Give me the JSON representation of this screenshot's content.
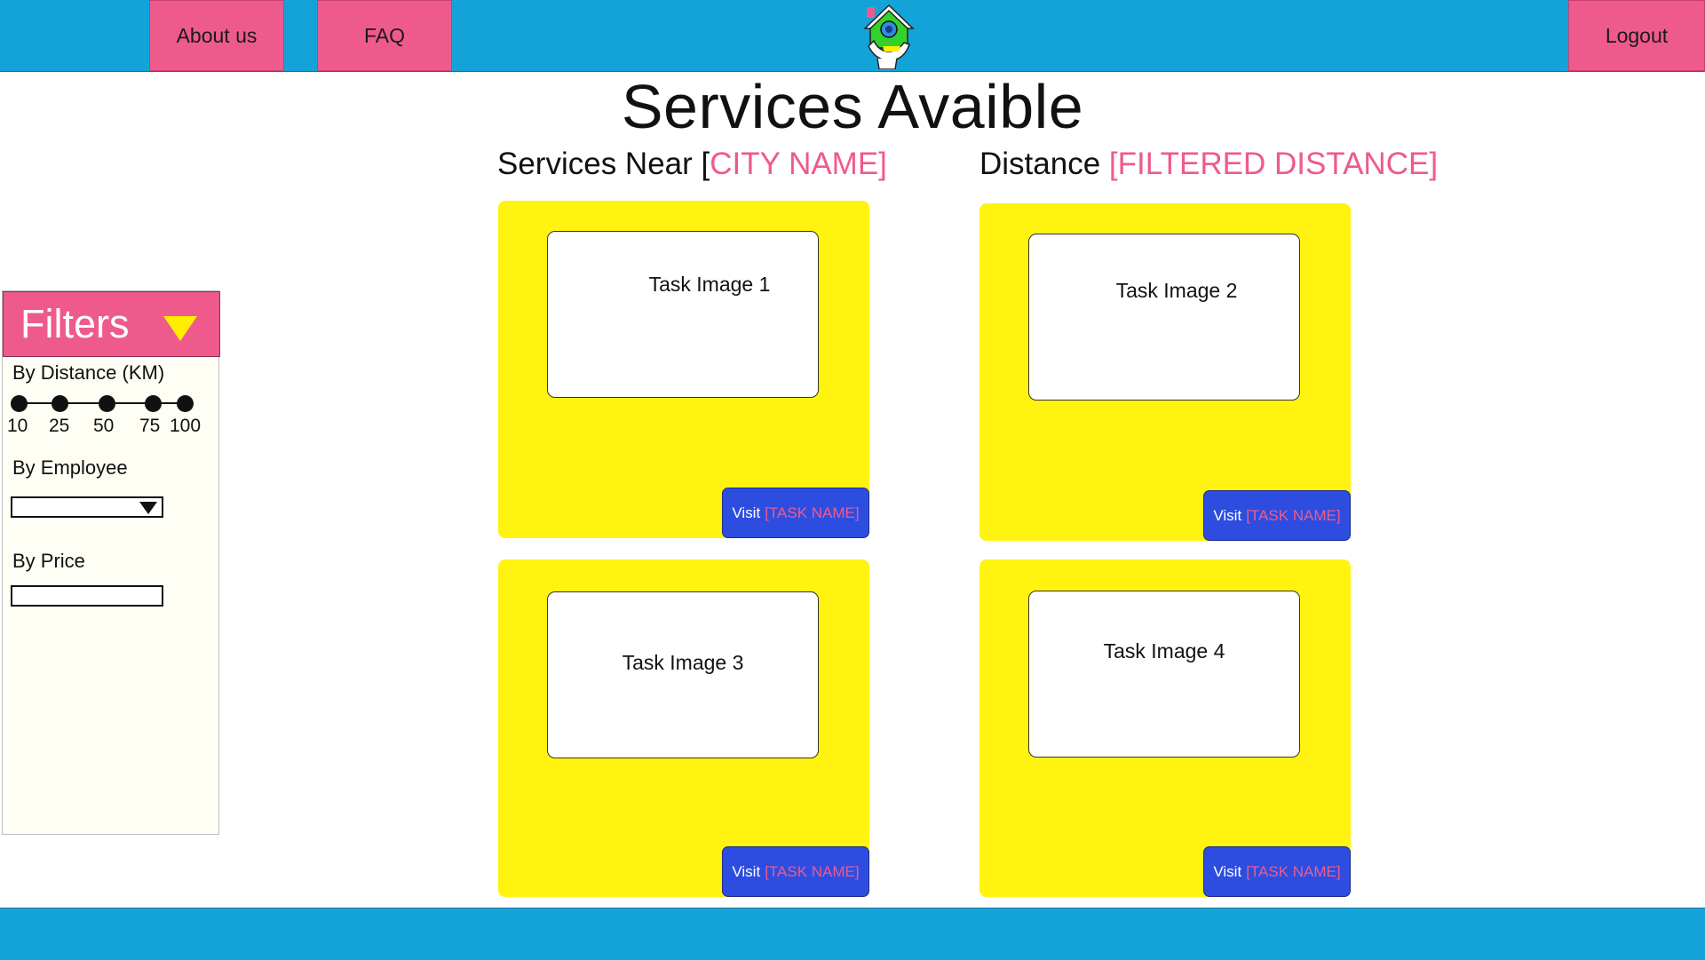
{
  "nav": {
    "about": "About us",
    "faq": "FAQ",
    "logout": "Logout",
    "logo_icon": "house-hand-logo-icon"
  },
  "page": {
    "title": "Services Avaible",
    "near_prefix": "Services Near [",
    "city_placeholder": "CITY NAME]",
    "distance_prefix": "Distance ",
    "distance_placeholder": "[FILTERED DISTANCE]"
  },
  "filters": {
    "title": "Filters",
    "by_distance": "By Distance (KM)",
    "distance_options": [
      "10",
      "25",
      "50",
      "75",
      "100"
    ],
    "by_employee": "By Employee",
    "employee_selected": "",
    "by_price": "By Price",
    "price_value": ""
  },
  "cards": [
    {
      "image_label": "Task Image 1",
      "visit_label": "Visit",
      "task_placeholder": "[TASK NAME]"
    },
    {
      "image_label": "Task Image 2",
      "visit_label": "Visit",
      "task_placeholder": "[TASK NAME]"
    },
    {
      "image_label": "Task Image 3",
      "visit_label": "Visit",
      "task_placeholder": "[TASK NAME]"
    },
    {
      "image_label": "Task Image 4",
      "visit_label": "Visit",
      "task_placeholder": "[TASK NAME]"
    }
  ],
  "colors": {
    "bar_blue": "#14a3d9",
    "accent_pink": "#ef5a8d",
    "card_yellow": "#fff30f",
    "button_blue": "#2d4de0"
  }
}
